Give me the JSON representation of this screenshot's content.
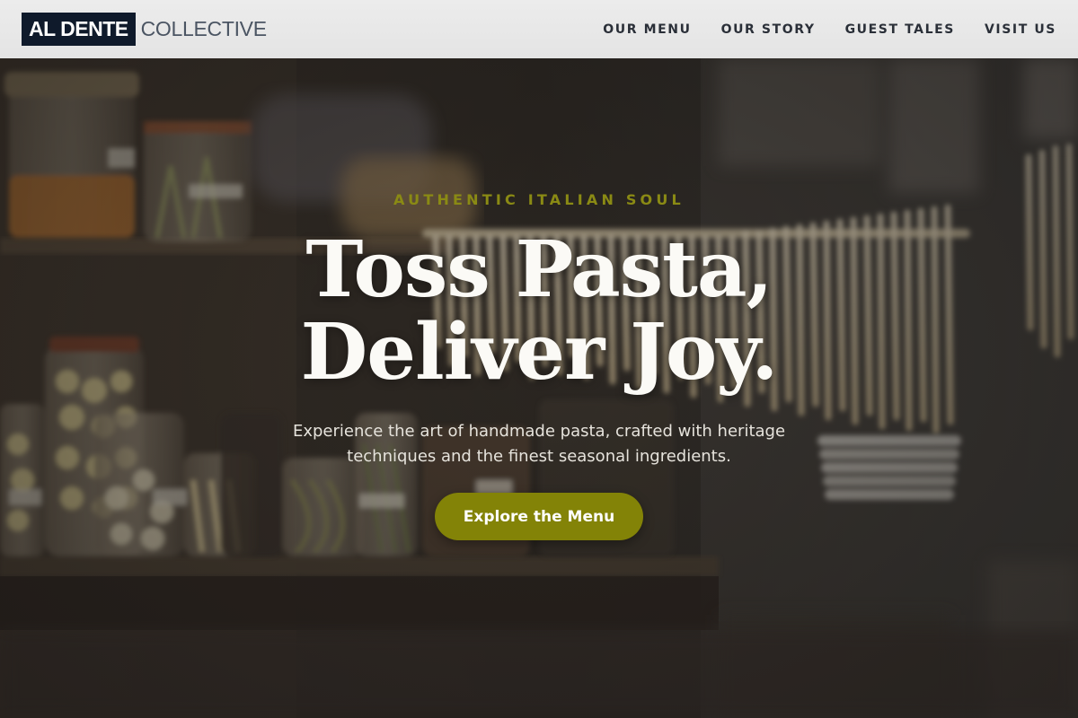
{
  "brand": {
    "name_primary": "AL DENTE",
    "name_secondary": "COLLECTIVE",
    "colors": {
      "navy": "#0f1a2b",
      "olive": "#838307",
      "eyebrow": "#8a8a14"
    }
  },
  "nav": {
    "items": [
      {
        "label": "OUR MENU"
      },
      {
        "label": "OUR STORY"
      },
      {
        "label": "GUEST TALES"
      },
      {
        "label": "VISIT US"
      }
    ]
  },
  "hero": {
    "eyebrow": "AUTHENTIC ITALIAN SOUL",
    "headline_line1": "Toss Pasta,",
    "headline_line2": "Deliver Joy.",
    "subtext_line1": "Experience the art of handmade pasta, crafted with heritage",
    "subtext_line2": "techniques and the finest seasonal ingredients.",
    "cta_label": "Explore the Menu"
  }
}
